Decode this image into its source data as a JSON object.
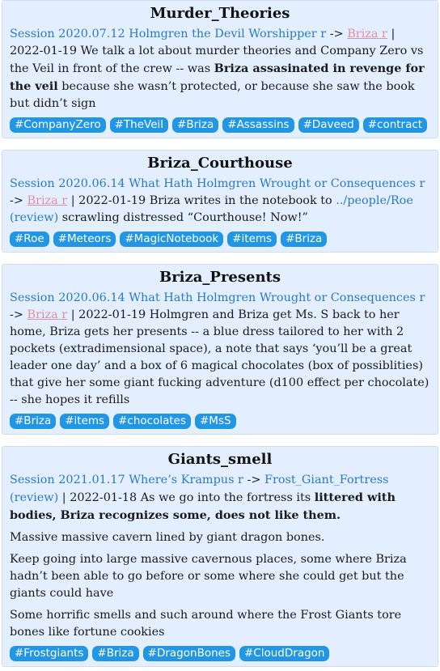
{
  "cards": [
    {
      "title": "Murder_Theories",
      "session_link": "Session 2020.07.12 Holmgren the Devil Worshipper r",
      "arrow": " -> ",
      "people_link": "Briza r",
      "sep": " | ",
      "date": "2022-01-19",
      "text_before_bold": " We talk a lot about murder theories and Company Zero vs the Veil in front of the crew -- was ",
      "bold_text": "Briza assasinated in revenge for the veil",
      "text_after_bold": " because she wasn’t protected, or because she saw the book but didn’t sign",
      "tags": [
        "#CompanyZero",
        "#TheVeil",
        "#Briza",
        "#Assassins",
        "#Daveed",
        "#contract"
      ]
    },
    {
      "title": "Briza_Courthouse",
      "session_link": "Session 2020.06.14 What Hath Holmgren Wrought or Consequences r",
      "arrow": " -> ",
      "people_link": "Briza r",
      "sep": " | ",
      "date": "2022-01-19",
      "text_before_link": " Briza writes in the notebook to ",
      "inline_link": "../people/Roe (review)",
      "text_after_link": " scrawling distressed “Courthouse! Now!”",
      "tags": [
        "#Roe",
        "#Meteors",
        "#MagicNotebook",
        "#items",
        "#Briza"
      ]
    },
    {
      "title": "Briza_Presents",
      "session_link": "Session 2020.06.14 What Hath Holmgren Wrought or Consequences r",
      "arrow": " -> ",
      "people_link": "Briza r",
      "sep": " | ",
      "date": "2022-01-19",
      "text": " Holmgren and Briza get Ms. S back to her home, Briza gets her presents -- a blue dress tailored to her with 2 pockets (extradimensional space), a note that says ‘you’ll be a great leader one day’ and a box of 6 magical chocolates (box of possiblities) that give her some giant fucking adventure (d100 effect per chocolate) -- she hopes it refills",
      "tags": [
        "#Briza",
        "#items",
        "#chocolates",
        "#MsS"
      ]
    },
    {
      "title": "Giants_smell",
      "session_link": "Session 2021.01.17 Where’s Krampus r",
      "arrow": " -> ",
      "fortress_link": "Frost_Giant_Fortress (review)",
      "sep": " | ",
      "date": "2022-01-18",
      "text_before_bold": " As we go into the fortress its ",
      "bold_text": "littered with bodies, Briza recognizes some, does not like them.",
      "para2": "Massive massive cavern lined by giant dragon bones.",
      "para3": "Keep going into large massive cavernous places, some where Briza hadn’t been able to go before or some where she could get but the giants could have",
      "para4": "Some horrific smells and such around where the Frost Giants tore bones like fortune cookies",
      "tags": [
        "#Frostgiants",
        "#Briza",
        "#DragonBones",
        "#CloudDragon"
      ]
    }
  ]
}
